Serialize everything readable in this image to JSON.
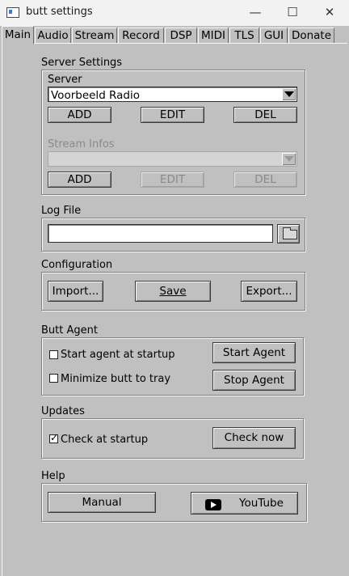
{
  "window": {
    "title": "butt settings",
    "minimize": "—",
    "maximize": "☐",
    "close": "✕"
  },
  "tabs": [
    "Main",
    "Audio",
    "Stream",
    "Record",
    "DSP",
    "MIDI",
    "TLS",
    "GUI",
    "Donate"
  ],
  "server_settings": {
    "heading": "Server Settings",
    "server_label": "Server",
    "server_value": "Voorbeeld Radio",
    "add": "ADD",
    "edit": "EDIT",
    "del": "DEL",
    "stream_infos_label": "Stream Infos",
    "stream_infos_value": "",
    "si_add": "ADD",
    "si_edit": "EDIT",
    "si_del": "DEL"
  },
  "log_file": {
    "heading": "Log File",
    "value": ""
  },
  "configuration": {
    "heading": "Configuration",
    "import": "Import...",
    "save": "Save",
    "export": "Export..."
  },
  "butt_agent": {
    "heading": "Butt Agent",
    "start_at_startup": "Start agent at startup",
    "start_at_startup_checked": false,
    "minimize_to_tray": "Minimize butt to tray",
    "minimize_to_tray_checked": false,
    "start_agent": "Start Agent",
    "stop_agent": "Stop Agent"
  },
  "updates": {
    "heading": "Updates",
    "check_at_startup": "Check at startup",
    "check_at_startup_checked": true,
    "check_now": "Check now",
    "check_mark": "✓"
  },
  "help": {
    "heading": "Help",
    "manual": "Manual",
    "youtube": "YouTube"
  }
}
